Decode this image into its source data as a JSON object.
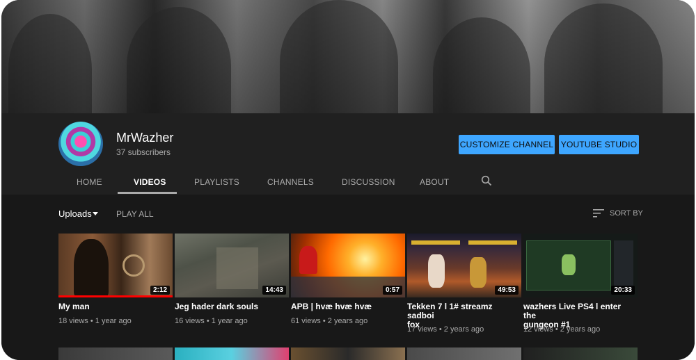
{
  "channel": {
    "name": "MrWazher",
    "subscribers": "37 subscribers"
  },
  "buttons": {
    "customize": "CUSTOMIZE CHANNEL",
    "studio": "YOUTUBE STUDIO"
  },
  "tabs": [
    "HOME",
    "VIDEOS",
    "PLAYLISTS",
    "CHANNELS",
    "DISCUSSION",
    "ABOUT"
  ],
  "active_tab": "VIDEOS",
  "toolbar": {
    "uploads": "Uploads",
    "play_all": "PLAY ALL",
    "sort_by": "SORT BY"
  },
  "videos": [
    {
      "title": "My man",
      "title2": "",
      "views": "18 views",
      "age": "1 year ago",
      "duration": "2:12",
      "watched": 1.0
    },
    {
      "title": "Jeg hader dark souls",
      "title2": "",
      "views": "16 views",
      "age": "1 year ago",
      "duration": "14:43",
      "watched": 0
    },
    {
      "title": "APB | hvæ hvæ hvæ",
      "title2": "",
      "views": "61 views",
      "age": "2 years ago",
      "duration": "0:57",
      "watched": 0
    },
    {
      "title": "Tekken 7 l 1# streamz sadboi",
      "title2": "fox",
      "views": "17 views",
      "age": "2 years ago",
      "duration": "49:53",
      "watched": 0
    },
    {
      "title": "wazhers Live PS4 l enter the",
      "title2": "gungeon #1",
      "views": "12 views",
      "age": "2 years ago",
      "duration": "20:33",
      "watched": 0
    }
  ],
  "colors": {
    "accent": "#3ea6ff",
    "progress": "#ff0000",
    "background": "#181818",
    "header": "#202020"
  },
  "icons": {
    "search": "search-icon",
    "sort": "sort-icon",
    "dropdown": "chevron-down-icon"
  }
}
